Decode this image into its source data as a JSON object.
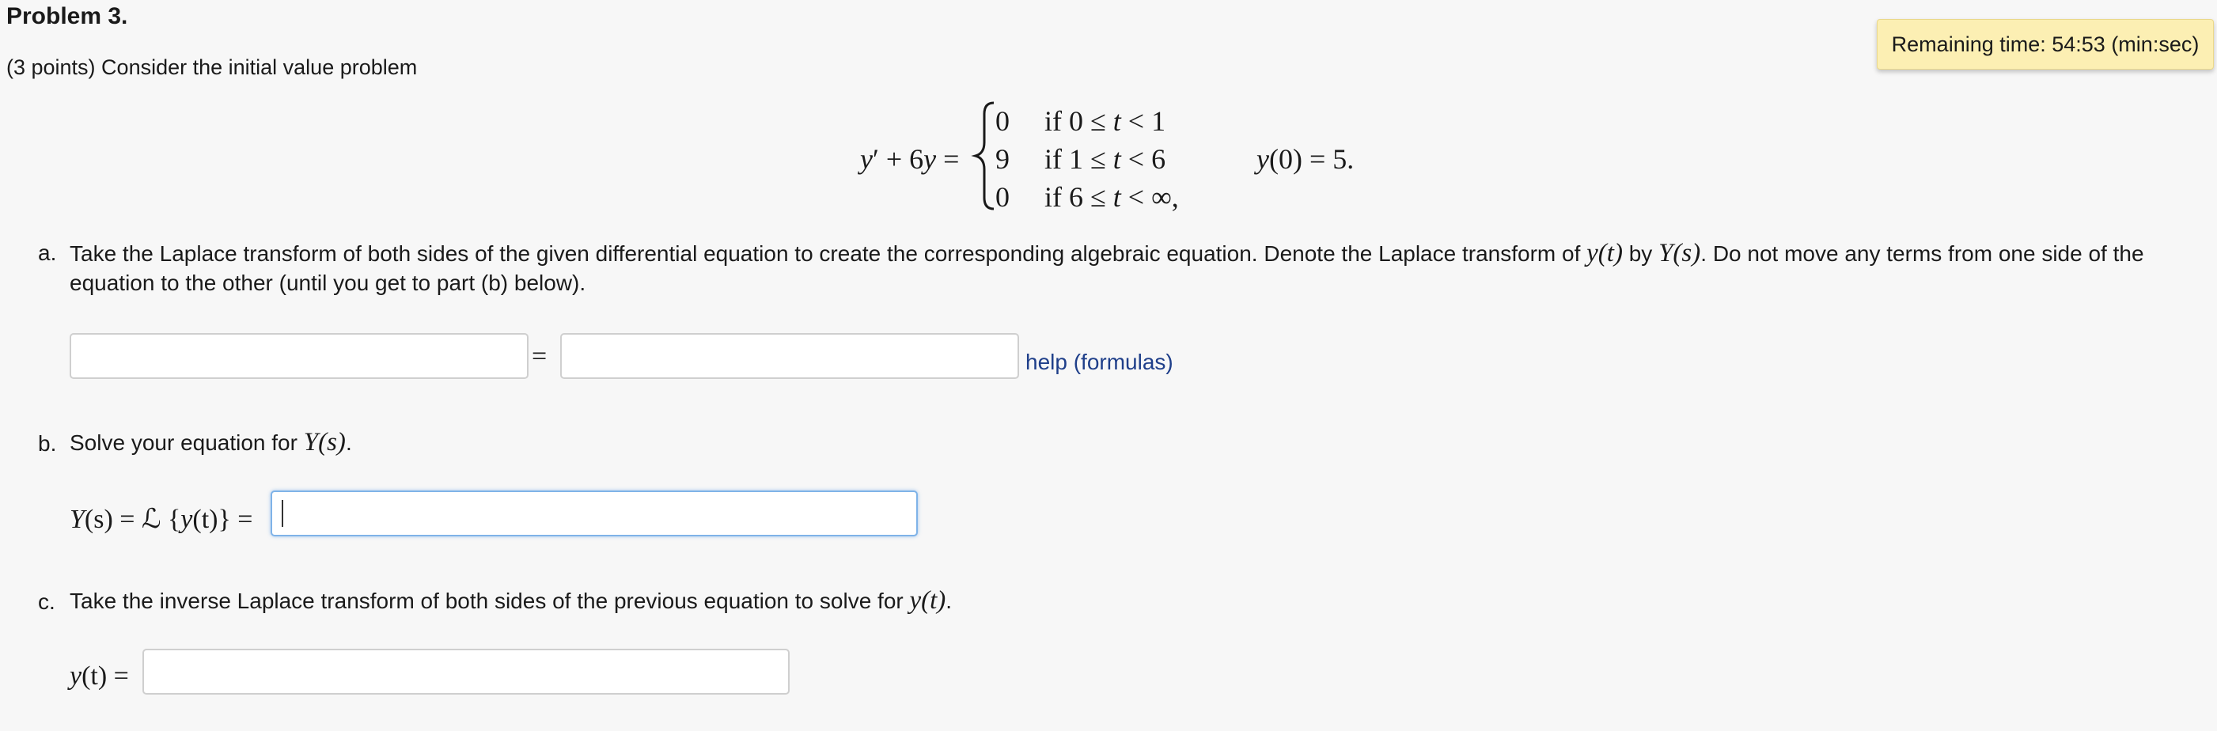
{
  "problem": {
    "title": "Problem 3.",
    "intro": "(3 points) Consider the initial value problem"
  },
  "timer": {
    "text": "Remaining time: 54:53 (min:sec)"
  },
  "equation": {
    "lhs_y": "y",
    "lhs_prime": "′",
    "lhs_rest": "+ 6",
    "lhs_y2": "y",
    "lhs_eq": "=",
    "cases": [
      {
        "value": "0",
        "cond_pre": "if 0 ≤ ",
        "cond_var": "t",
        "cond_post": " < 1"
      },
      {
        "value": "9",
        "cond_pre": "if 1 ≤ ",
        "cond_var": "t",
        "cond_post": " < 6"
      },
      {
        "value": "0",
        "cond_pre": "if 6 ≤ ",
        "cond_var": "t",
        "cond_post": " < ∞,"
      }
    ],
    "initial_y": "y",
    "initial_rest": "(0) = 5."
  },
  "part_a": {
    "letter": "a.",
    "line1_pre": "Take the Laplace transform of both sides of the given differential equation to create the corresponding algebraic equation. Denote the Laplace transform of ",
    "line1_m1": "y(t)",
    "line1_mid": " by ",
    "line1_m2": "Y(s)",
    "line1_post": ". Do not move any terms from one side of the",
    "line2": "equation to the other (until you get to part (b) below).",
    "equals": "=",
    "lhs_value": "",
    "rhs_value": "",
    "help_link": "help (formulas)"
  },
  "part_b": {
    "letter": "b.",
    "text_pre": "Solve your equation for ",
    "text_math": "Y(s)",
    "text_post": ".",
    "label_Y": "Y",
    "label_s": "(s) = ℒ {",
    "label_y": "y",
    "label_t": "(t)} =",
    "answer_value": ""
  },
  "part_c": {
    "letter": "c.",
    "text_pre": "Take the inverse Laplace transform of both sides of the previous equation to solve for ",
    "text_math": "y(t)",
    "text_post": ".",
    "label_y": "y",
    "label_t": "(t) =",
    "answer_value": ""
  }
}
